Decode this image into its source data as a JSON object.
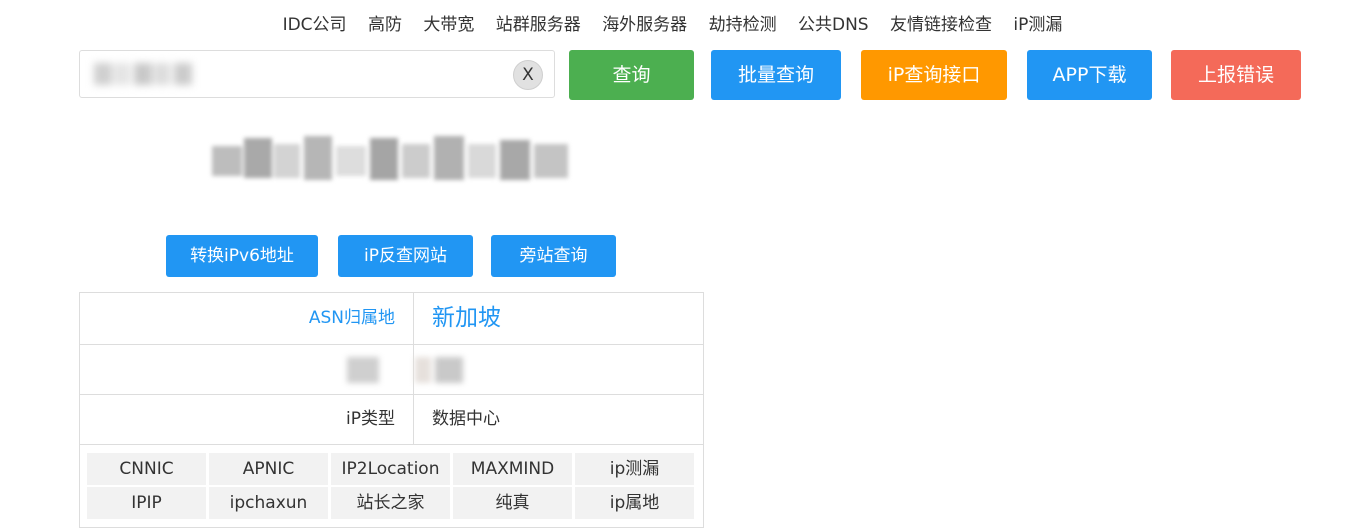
{
  "nav": [
    "IDC公司",
    "高防",
    "大带宽",
    "站群服务器",
    "海外服务器",
    "劫持检测",
    "公共DNS",
    "友情链接检查",
    "iP测漏"
  ],
  "search": {
    "value": "",
    "clear_label": "X"
  },
  "buttons": {
    "query": "查询",
    "batch_query": "批量查询",
    "ip_api": "iP查询接口",
    "app_download": "APP下载",
    "report_error": "上报错误"
  },
  "tools": {
    "ipv6": "转换iPv6地址",
    "reverse": "iP反查网站",
    "sidesite": "旁站查询"
  },
  "info": {
    "asn_label": "ASN归属地",
    "asn_value": "新加坡",
    "type_label": "iP类型",
    "type_value": "数据中心"
  },
  "sources": [
    [
      "CNNIC",
      "APNIC",
      "IP2Location",
      "MAXMIND",
      "ip测漏"
    ],
    [
      "IPIP",
      "ipchaxun",
      "站长之家",
      "纯真",
      "ip属地"
    ]
  ],
  "colors": {
    "green": "#4caf50",
    "blue": "#2196f3",
    "orange": "#ff9800",
    "red": "#f46a59",
    "link_blue": "#2196f3"
  }
}
